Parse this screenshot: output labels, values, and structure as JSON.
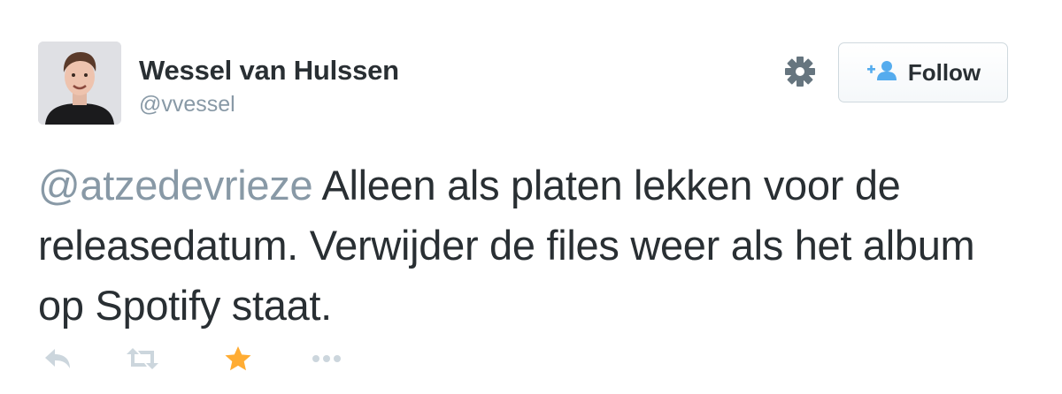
{
  "user": {
    "name": "Wessel van Hulssen",
    "handle": "@vvessel"
  },
  "follow_button": {
    "label": "Follow",
    "icon": "follow-user-icon"
  },
  "settings": {
    "icon": "gear-icon"
  },
  "tweet": {
    "mention": "@atzedevrieze",
    "text": " Alleen als platen lekken voor de releasedatum. Verwijder de files weer als het album op Spotify staat."
  },
  "actions": [
    {
      "name": "reply",
      "icon": "reply-icon"
    },
    {
      "name": "retweet",
      "icon": "retweet-icon"
    },
    {
      "name": "favorite",
      "icon": "star-icon",
      "active": true
    },
    {
      "name": "more",
      "icon": "more-dots-icon"
    }
  ],
  "colors": {
    "muted": "#8899a6",
    "text": "#292f33",
    "favorite": "#ffac33",
    "follow_icon": "#55acee"
  }
}
